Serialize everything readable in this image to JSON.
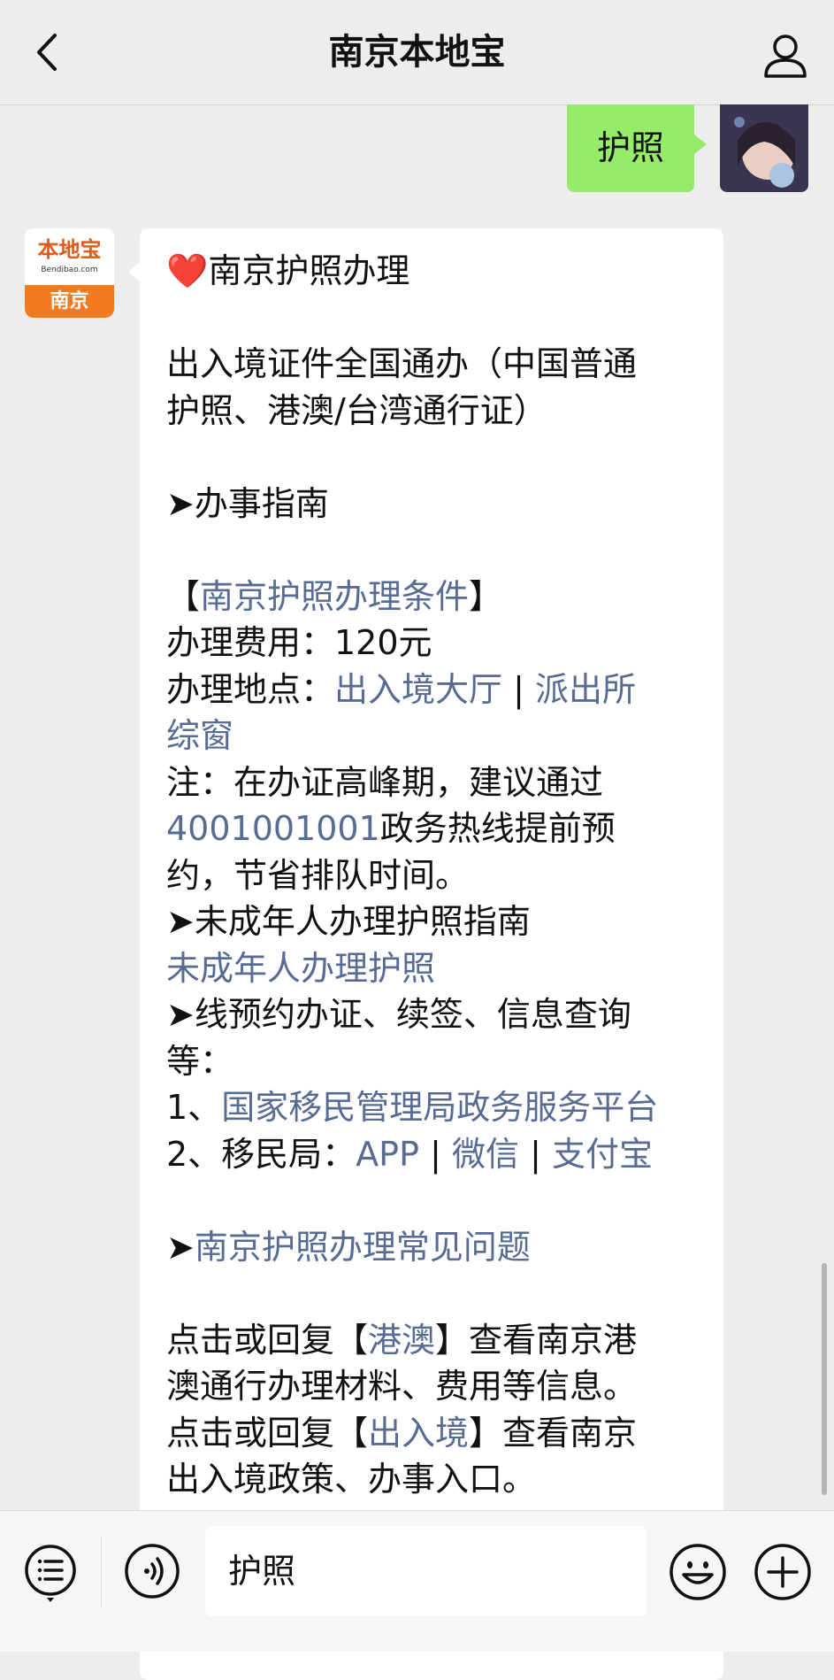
{
  "header": {
    "title": "南京本地宝"
  },
  "sent_message": {
    "text": "护照"
  },
  "bot": {
    "avatar_logo": "本地宝",
    "avatar_site": "Bendibao.com",
    "avatar_city": "南京"
  },
  "message": {
    "heart_icon": "❤️",
    "title": "南京护照办理",
    "intro_1": "出入境证件全国通办（中国普通",
    "intro_2": "护照、港澳/台湾通行证）",
    "guide_heading": "➤办事指南",
    "cond_open": "【",
    "cond_link": "南京护照办理条件",
    "cond_close": "】",
    "fee": "办理费用：120元",
    "place_label": "办理地点：",
    "place_link1": "出入境大厅",
    "sep1": " | ",
    "place_link2": "派出所",
    "place_link2b": "综窗",
    "note_1": "注：在办证高峰期，建议通过",
    "hotline_link": "4001001001",
    "note_2": "政务热线提前预",
    "note_3": "约，节省排队时间。",
    "minor_heading": "➤未成年人办理护照指南",
    "minor_link": "未成年人办理护照",
    "online_1": "➤线预约办证、续签、信息查询",
    "online_2": "等：",
    "item1_prefix": "1、",
    "item1_link": "国家移民管理局政务服务平台",
    "item2_prefix": "2、移民局：",
    "app_link": "APP",
    "sep2": " | ",
    "wechat_link": "微信",
    "sep3": " | ",
    "alipay_link": "支付宝",
    "faq_arrow": "➤",
    "faq_link": "南京护照办理常见问题",
    "hk_1a": "点击或回复【",
    "hk_link": "港澳",
    "hk_1b": "】查看南京港",
    "hk_2": "澳通行办理材料、费用等信息。",
    "exit_1a": "点击或回复【",
    "exit_link": "出入境",
    "exit_1b": "】查看南京",
    "exit_2": "出入境政策、办事入口。"
  },
  "composer": {
    "input_value": "护照"
  },
  "icons": {
    "back": "chevron-left",
    "profile": "person-outline",
    "menu": "list-circle",
    "voice": "voice-circle",
    "emoji": "smiley",
    "plus": "plus-circle"
  },
  "colors": {
    "sent_bubble": "#95ec69",
    "link": "#576b95",
    "background": "#ededed"
  }
}
